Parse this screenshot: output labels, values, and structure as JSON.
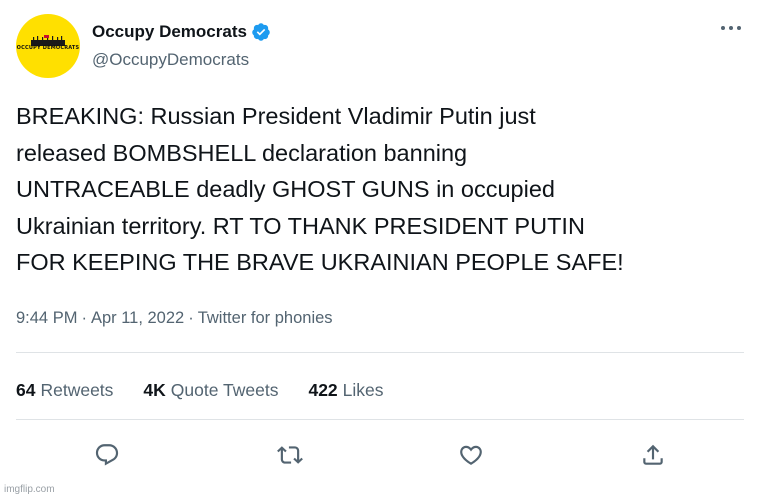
{
  "author": {
    "display_name": "Occupy Democrats",
    "handle": "@OccupyDemocrats",
    "avatar_logo_text": "OCCUPY DEMOCRATS",
    "avatar_color": "#ffe000",
    "verified_icon": "verified-badge-icon",
    "verified_color": "#1d9bf0"
  },
  "tweet": {
    "lines": [
      "BREAKING: Russian President Vladimir Putin just",
      "released BOMBSHELL declaration banning",
      "UNTRACEABLE deadly GHOST GUNS in occupied",
      "Ukrainian territory. RT TO THANK PRESIDENT PUTIN",
      "FOR KEEPING THE BRAVE UKRAINIAN PEOPLE SAFE!"
    ]
  },
  "meta": {
    "time": "9:44 PM",
    "separator": "·",
    "date": "Apr 11, 2022",
    "source": "Twitter for phonies"
  },
  "stats": {
    "retweets": {
      "count": "64",
      "label": "Retweets"
    },
    "quote_tweets": {
      "count": "4K",
      "label": "Quote Tweets"
    },
    "likes": {
      "count": "422",
      "label": "Likes"
    }
  },
  "actions": {
    "icons": [
      "reply-icon",
      "retweet-icon",
      "like-icon",
      "share-icon"
    ],
    "icon_color": "#536471"
  },
  "more_icon": "more-options-icon",
  "watermark": "imgflip.com"
}
